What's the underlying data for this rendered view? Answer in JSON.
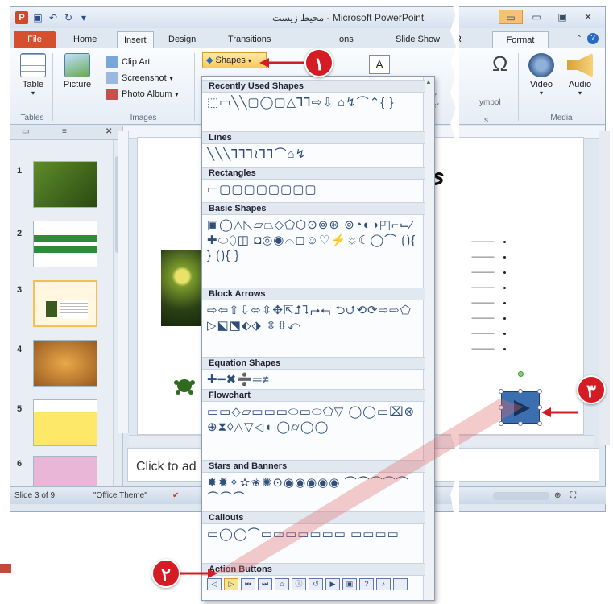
{
  "window": {
    "title": "محیط زیست - Microsoft PowerPoint",
    "app_icon": "P"
  },
  "tabs": {
    "file": "File",
    "home": "Home",
    "insert": "Insert",
    "design": "Design",
    "transitions": "Transitions",
    "animations": "ons",
    "slideshow": "Slide Show",
    "review": "R",
    "format": "Format"
  },
  "ribbon": {
    "table": "Table",
    "picture": "Picture",
    "clipart": "Clip Art",
    "screenshot": "Screenshot",
    "photoalbum": "Photo Album",
    "shapes": "Shapes",
    "symbol": "ymbol",
    "video": "Video",
    "audio": "Audio",
    "grp_tables": "Tables",
    "grp_images": "Images",
    "grp_media": "Media",
    "grp_text_partial": "Text",
    "grp_illus_partial": "er",
    "grp_illus_partial2": "ter",
    "grp_symbols_partial": "s"
  },
  "left_pane": {
    "slide_numbers": [
      "1",
      "2",
      "3",
      "4",
      "5",
      "6"
    ]
  },
  "notes": {
    "placeholder": "Click to ad"
  },
  "slide": {
    "title_partial": "ی"
  },
  "status": {
    "slide_of": "Slide 3 of 9",
    "theme": "\"Office Theme\""
  },
  "gallery": {
    "sections": [
      {
        "name": "Recently Used Shapes",
        "shapes": "⬚▭╲╲▢◯▢△⅂⅂⇨⇩ ⌂↯⌒⌃{ }"
      },
      {
        "name": "Lines",
        "shapes": "╲╲╲⅂⅂⅂≀⅂⅂⌒⌂↯"
      },
      {
        "name": "Rectangles",
        "shapes": "▭▢▢▢▢▢▢▢▢"
      },
      {
        "name": "Basic Shapes",
        "shapes": "▣◯△◺▱⏢◇⬠⬡⊙⊚⊛ ⊚◔◐◑◰⌐⌙⁄✚⬭⬯◫ ◘◎◉⌒◻☺♡⚡☼☾◯⌒ ⟮⟯{ } ⟮⟯{ }"
      },
      {
        "name": "Block Arrows",
        "shapes": "⇨⇦⇧⇩⬄⇳✥⇱⮥⮧⮣⮢ ⮌⮍⟲⟳⇨⇨⬠▷⬕⬔⬖⬗ ⇳⇳⤺"
      },
      {
        "name": "Equation Shapes",
        "shapes": "✚━✖➗═≠"
      },
      {
        "name": "Flowchart",
        "shapes": "▭▭◇▱▭▭▭⬭▭⬭⬠▽ ◯◯▭⌧⊗⊕⧗◊△▽◁◖ ◯⌭◯◯"
      },
      {
        "name": "Stars and Banners",
        "shapes": "✸✹✧✫✬✺⊙◉◉◉◉◉ ⌒⌒⌒⌒⌒⌒⌒⌒"
      },
      {
        "name": "Callouts",
        "shapes": "▭◯◯⌒▭▭▭▭▭▭▭ ▭▭▭▭"
      },
      {
        "name": "Action Buttons",
        "shapes": ""
      }
    ],
    "action_buttons": [
      "◁",
      "▷",
      "⏮",
      "⏭",
      "⌂",
      "ⓘ",
      "↺",
      "▶",
      "▣",
      "?",
      "♪",
      " "
    ]
  },
  "callouts": {
    "c1": "۱",
    "c2": "۲",
    "c3": "۳"
  },
  "colors": {
    "callout_red": "#d41c24",
    "file_tab": "#d5502c",
    "highlight": "#f8c95c"
  }
}
